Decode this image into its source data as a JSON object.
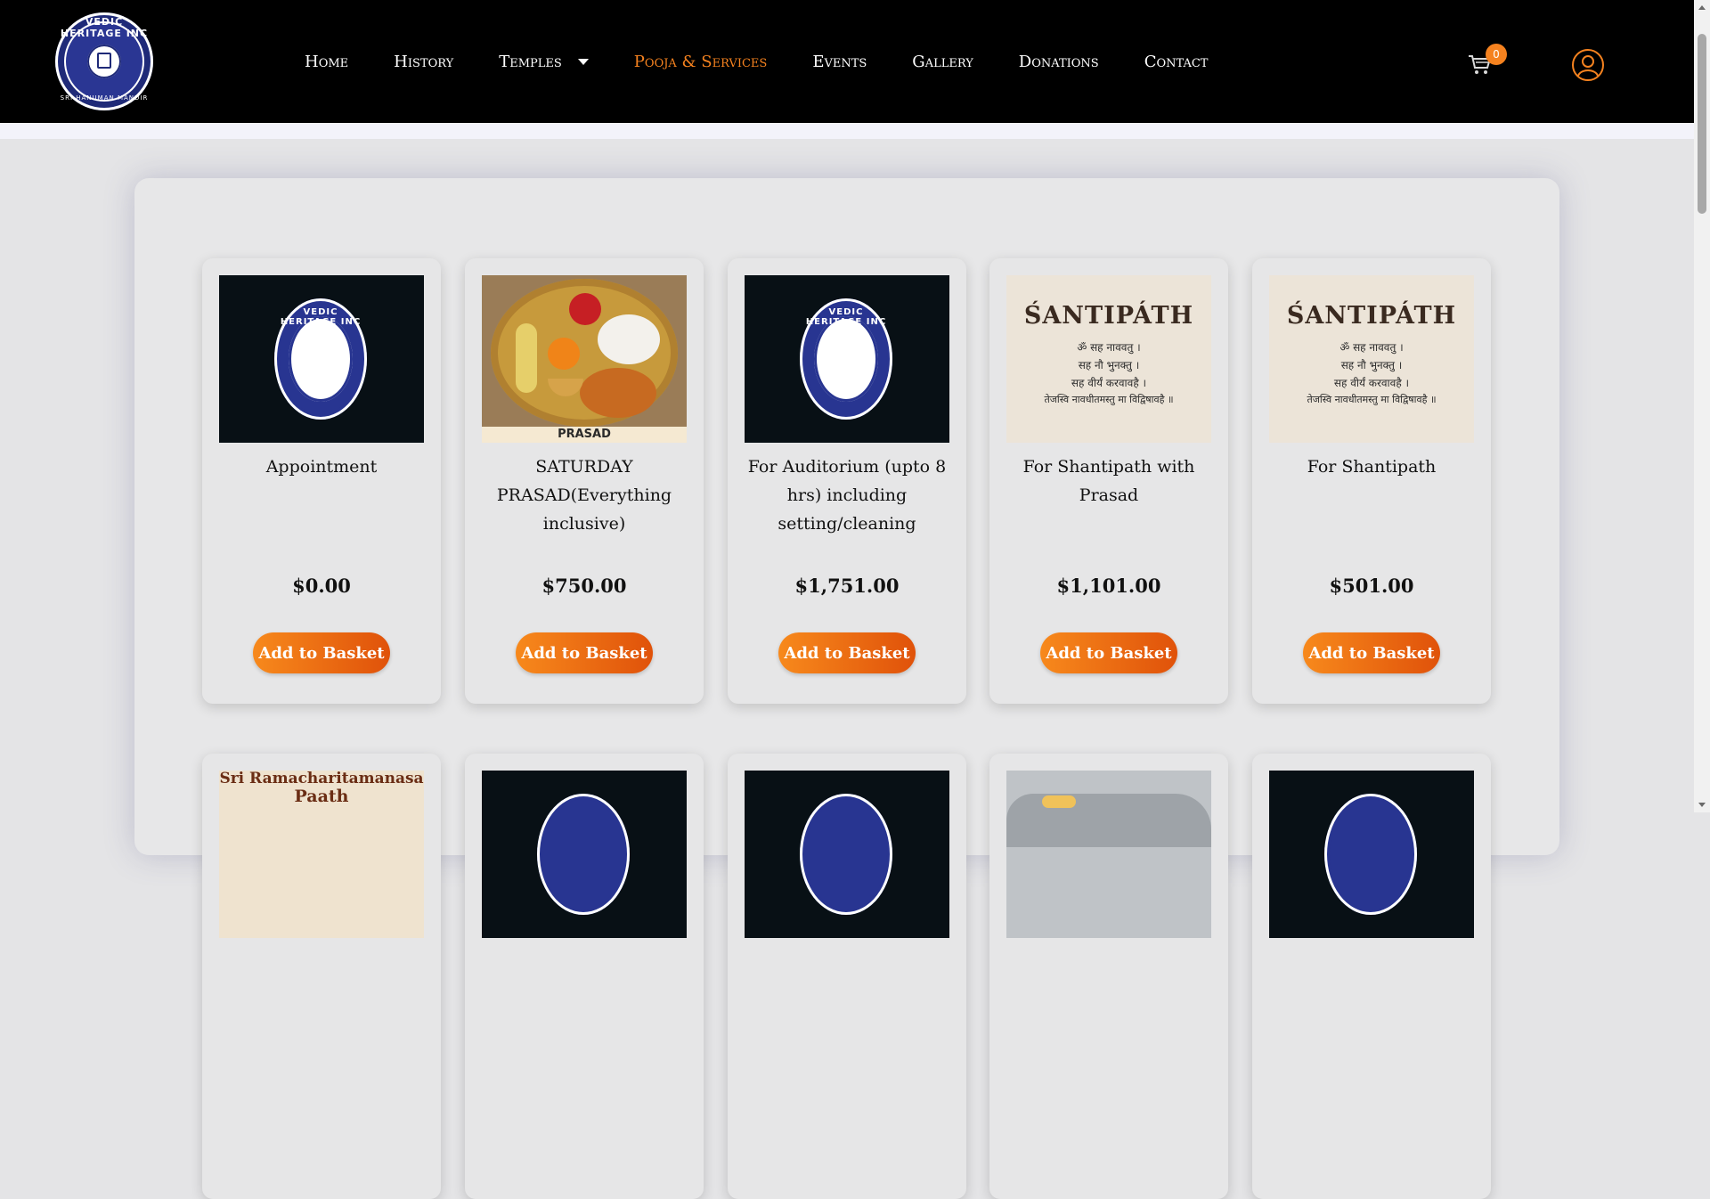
{
  "header": {
    "logo": {
      "top_text": "VEDIC HERITAGE INC",
      "bottom_text": "SRI HANUMAN MANDIR"
    },
    "nav": [
      {
        "label": "Home",
        "active": false
      },
      {
        "label": "History",
        "active": false
      },
      {
        "label": "Temples",
        "active": false,
        "dropdown": true
      },
      {
        "label": "Pooja & Services",
        "active": true
      },
      {
        "label": "Events",
        "active": false
      },
      {
        "label": "Gallery",
        "active": false
      },
      {
        "label": "Donations",
        "active": false
      },
      {
        "label": "Contact",
        "active": false
      }
    ],
    "cart_count": "0",
    "accent_color": "#f5821f"
  },
  "services": [
    {
      "title": "Appointment",
      "price": "$0.00",
      "button": "Add to Basket",
      "image": "vedic-heritage-logo"
    },
    {
      "title": "SATURDAY PRASAD(Everything inclusive)",
      "price": "$750.00",
      "button": "Add to Basket",
      "image": "prasad-plate",
      "image_caption": "PRASAD"
    },
    {
      "title": "For Auditorium (upto 8 hrs) including setting/cleaning",
      "price": "$1,751.00",
      "button": "Add to Basket",
      "image": "vedic-heritage-logo"
    },
    {
      "title": "For Shantipath with Prasad",
      "price": "$1,101.00",
      "button": "Add to Basket",
      "image": "santipath-text"
    },
    {
      "title": "For Shantipath",
      "price": "$501.00",
      "button": "Add to Basket",
      "image": "santipath-text"
    }
  ],
  "santipath_image": {
    "title": "ŚANTIPÁTH",
    "lines": [
      "ॐ सह नाववतु ।",
      "सह नौ भुनक्तु ।",
      "सह वीर्यं करवावहै ।",
      "तेजस्वि नावधीतमस्तु मा विद्विषावहै ॥"
    ]
  },
  "second_row": {
    "card1_image_text": [
      "Sri Ramacharitamanasa",
      "Paath"
    ]
  }
}
